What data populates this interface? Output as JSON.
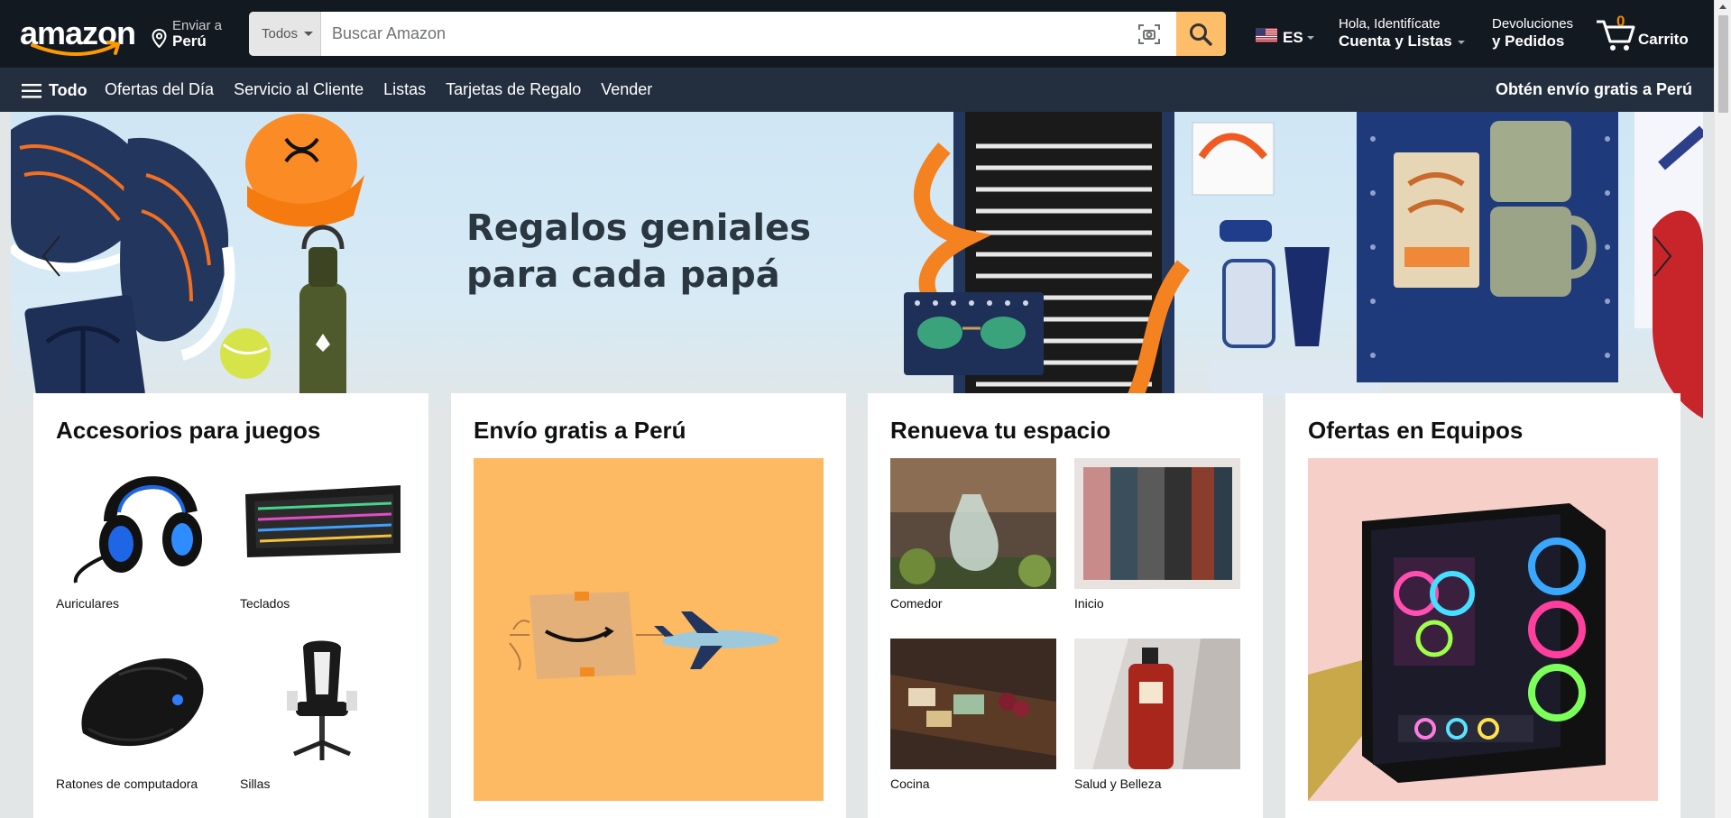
{
  "header": {
    "logo_text": "amazon",
    "deliver_line1": "Enviar a",
    "deliver_line2": "Perú",
    "search_category": "Todos",
    "search_placeholder": "Buscar Amazon",
    "language": "ES",
    "account_line1": "Hola, Identifícate",
    "account_line2": "Cuenta y Listas",
    "returns_line1": "Devoluciones",
    "returns_line2": "y Pedidos",
    "cart_count": "0",
    "cart_label": "Carrito"
  },
  "subnav": {
    "all_label": "Todo",
    "links": [
      "Ofertas del Día",
      "Servicio al Cliente",
      "Listas",
      "Tarjetas de Regalo",
      "Vender"
    ],
    "promo": "Obtén envío gratis a Perú"
  },
  "hero": {
    "title_line1": "Regalos geniales",
    "title_line2": "para cada papá"
  },
  "cards": [
    {
      "title": "Accesorios para juegos",
      "items": [
        "Auriculares",
        "Teclados",
        "Ratones de computadora",
        "Sillas"
      ]
    },
    {
      "title": "Envío gratis a Perú"
    },
    {
      "title": "Renueva tu espacio",
      "items": [
        "Comedor",
        "Inicio",
        "Cocina",
        "Salud y Belleza"
      ]
    },
    {
      "title": "Ofertas en Equipos"
    }
  ],
  "colors": {
    "header_bg": "#131921",
    "subnav_bg": "#232f3e",
    "search_button": "#febd69",
    "cart_count": "#f08804",
    "shipping_card_bg": "#feba62"
  }
}
